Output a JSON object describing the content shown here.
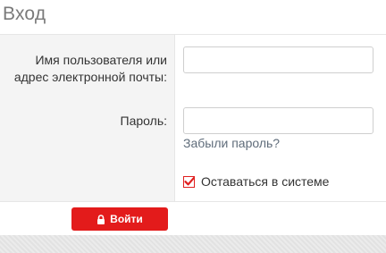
{
  "page": {
    "title": "Вход"
  },
  "form": {
    "username_label": "Имя пользователя или адрес электронной почты:",
    "username_value": "",
    "password_label": "Пароль:",
    "password_value": "",
    "forgot_link": "Забыли пароль?",
    "remember_label": "Оставаться в системе",
    "remember_checked": true,
    "login_button": "Войти"
  },
  "icons": {
    "checkbox": "checkmark-icon",
    "login": "lock-icon"
  },
  "colors": {
    "accent": "#e31b1b",
    "link": "#5f6c7a",
    "title": "#7a7a7a"
  }
}
